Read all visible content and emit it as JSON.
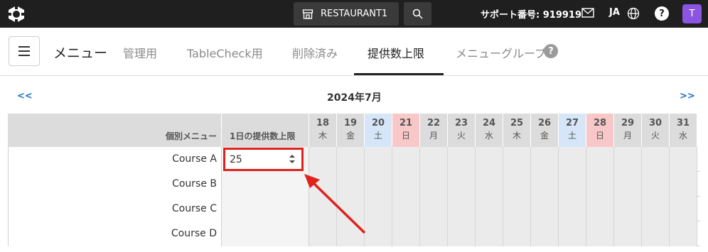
{
  "topbar": {
    "restaurant_label": "RESTAURANT1",
    "support_label": "サポート番号: 919919",
    "lang_label": "JA",
    "help_label": "?",
    "avatar_label": "T",
    "icons": [
      "logo-icon",
      "store-icon",
      "search-icon",
      "mail-icon",
      "globe-icon"
    ]
  },
  "nav": {
    "title": "メニュー",
    "tabs": [
      {
        "label": "管理用"
      },
      {
        "label": "TableCheck用"
      },
      {
        "label": "削除済み"
      },
      {
        "label": "提供数上限",
        "active": true
      },
      {
        "label": "メニューグループ"
      }
    ],
    "help_label": "?"
  },
  "calendar": {
    "prev_label": "<<",
    "next_label": ">>",
    "month_label": "2024年7月"
  },
  "table": {
    "col_menu": "個別メニュー",
    "col_limit": "1日の提供数上限",
    "days": [
      {
        "num": "18",
        "wd": "木",
        "type": "wk"
      },
      {
        "num": "19",
        "wd": "金",
        "type": "wk"
      },
      {
        "num": "20",
        "wd": "土",
        "type": "sat"
      },
      {
        "num": "21",
        "wd": "日",
        "type": "sun"
      },
      {
        "num": "22",
        "wd": "月",
        "type": "wk"
      },
      {
        "num": "23",
        "wd": "火",
        "type": "wk"
      },
      {
        "num": "24",
        "wd": "水",
        "type": "wk"
      },
      {
        "num": "25",
        "wd": "木",
        "type": "wk"
      },
      {
        "num": "26",
        "wd": "金",
        "type": "wk"
      },
      {
        "num": "27",
        "wd": "土",
        "type": "sat"
      },
      {
        "num": "28",
        "wd": "日",
        "type": "sun"
      },
      {
        "num": "29",
        "wd": "月",
        "type": "wk"
      },
      {
        "num": "30",
        "wd": "火",
        "type": "wk"
      },
      {
        "num": "31",
        "wd": "水",
        "type": "wk"
      }
    ],
    "rows": [
      {
        "name": "Course A",
        "limit": "25"
      },
      {
        "name": "Course B",
        "limit": ""
      },
      {
        "name": "Course C",
        "limit": ""
      },
      {
        "name": "Course D",
        "limit": ""
      }
    ]
  },
  "colors": {
    "topbar_bg": "#1f1f1f",
    "accent_red": "#e0211c",
    "link_blue": "#1a73c8",
    "saturday": "#d6e6f8",
    "sunday": "#f8c8c8",
    "avatar": "#8a55e0"
  }
}
